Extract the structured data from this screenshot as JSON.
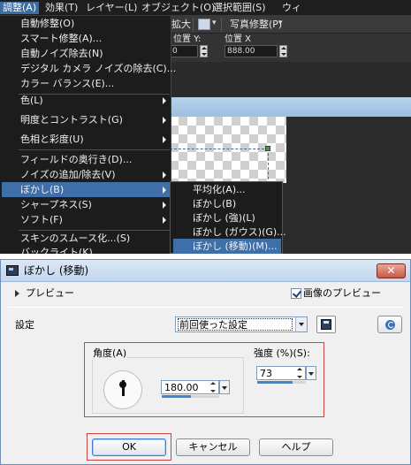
{
  "menubar": {
    "items": [
      "調整(A)",
      "効果(T)",
      "レイヤー(L)",
      "オブジェクト(O)",
      "選択範囲(S)",
      "ウィ"
    ],
    "active_index": 0
  },
  "toolbar1": {
    "fit_label": "拡大",
    "photo_fix_label": "写真修整(P)"
  },
  "toolbar2": {
    "y_label": "位置 Y:",
    "y_value": "0",
    "x_label": "位置 X",
    "x_value": "888.00"
  },
  "adjust_menu": {
    "items": [
      {
        "label": "自動修整(O)",
        "submenu": false
      },
      {
        "label": "スマート修整(A)...",
        "submenu": false
      },
      {
        "label": "自動ノイズ除去(N)",
        "submenu": false
      },
      {
        "label": "デジタル カメラ ノイズの除去(C)...",
        "submenu": false
      },
      {
        "label": "カラー バランス(E)...",
        "submenu": false
      },
      {
        "label": "色(L)",
        "submenu": true
      },
      {
        "label": "明度とコントラスト(G)",
        "submenu": true
      },
      {
        "label": "色相と彩度(U)",
        "submenu": true
      },
      {
        "label": "フィールドの奥行き(D)...",
        "submenu": false
      },
      {
        "label": "ノイズの追加/除去(V)",
        "submenu": true
      },
      {
        "label": "ぼかし(B)",
        "submenu": true,
        "highlighted": true
      },
      {
        "label": "シャープネス(S)",
        "submenu": true
      },
      {
        "label": "ソフト(F)",
        "submenu": true
      },
      {
        "label": "スキンのスムース化...(S)",
        "submenu": false
      },
      {
        "label": "バックライト(K)...",
        "submenu": false
      }
    ]
  },
  "blur_submenu": {
    "items": [
      {
        "label": "平均化(A)..."
      },
      {
        "label": "ぼかし(B)"
      },
      {
        "label": "ぼかし (強)(L)"
      },
      {
        "label": "ぼかし (ガウス)(G)..."
      },
      {
        "label": "ぼかし (移動)(M)...",
        "highlighted": true
      }
    ]
  },
  "dialog": {
    "title": "ぼかし (移動)",
    "close_label": "✕",
    "preview_toggle_label": "プレビュー",
    "image_preview_label": "画像のプレビュー",
    "image_preview_checked": true,
    "settings_label": "設定",
    "preset_value": "前回使った設定",
    "angle_label": "角度(A)",
    "angle_value": "180.00",
    "angle_fraction": 0.5,
    "strength_label": "強度 (%)(S):",
    "strength_value": "73",
    "strength_fraction": 0.73,
    "ok_label": "OK",
    "cancel_label": "キャンセル",
    "help_label": "ヘルプ"
  },
  "colors": {
    "menu_bg": "#1c1c1c",
    "menu_highlight": "#3e6fa8",
    "annotation_red": "#cc4444",
    "slider_blue": "#3a86d8"
  }
}
